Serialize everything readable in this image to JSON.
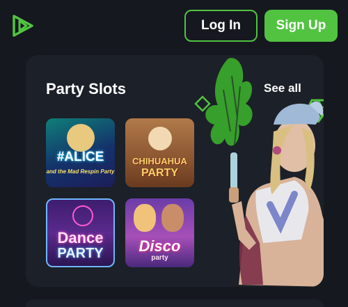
{
  "header": {
    "login_label": "Log In",
    "signup_label": "Sign Up",
    "logo_icon": "play-logo-icon",
    "accent": "#52c341"
  },
  "section": {
    "title": "Party Slots",
    "see_all_label": "See all"
  },
  "games": [
    {
      "name": "#ALICE",
      "subtitle": "and the Mad Respin Party"
    },
    {
      "name": "CHIHUAHUA",
      "subtitle": "PARTY"
    },
    {
      "name": "Dance",
      "subtitle": "PARTY"
    },
    {
      "name": "Disco",
      "subtitle": "party"
    }
  ]
}
